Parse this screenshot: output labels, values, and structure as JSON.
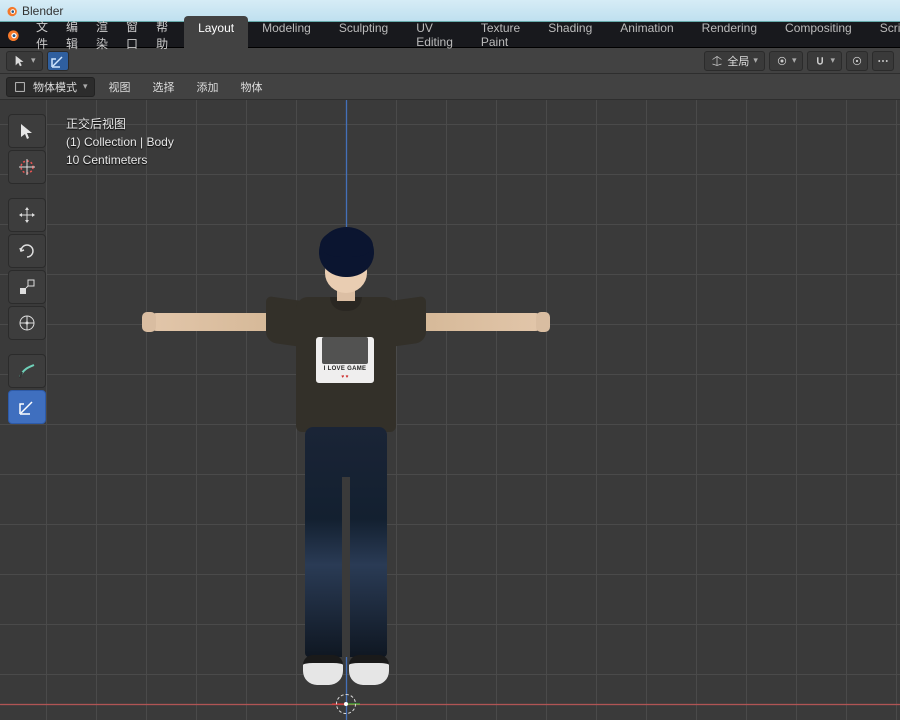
{
  "app": {
    "title": "Blender"
  },
  "menu": {
    "items": [
      "文件",
      "编辑",
      "渲染",
      "窗口",
      "帮助"
    ]
  },
  "workspace_tabs": {
    "tabs": [
      "Layout",
      "Modeling",
      "Sculpting",
      "UV Editing",
      "Texture Paint",
      "Shading",
      "Animation",
      "Rendering",
      "Compositing",
      "Scripting"
    ],
    "active": "Layout"
  },
  "header": {
    "orientation_label": "全局",
    "snap_tooltip": "Snap"
  },
  "subheader": {
    "mode": "物体模式",
    "menus": [
      "视图",
      "选择",
      "添加",
      "物体"
    ]
  },
  "hud": {
    "line1": "正交后视图",
    "line2": "(1) Collection | Body",
    "line3": "10 Centimeters"
  },
  "tools": [
    {
      "id": "select-box",
      "selected": false
    },
    {
      "id": "cursor",
      "selected": false
    },
    {
      "id": "move",
      "selected": false
    },
    {
      "id": "rotate",
      "selected": false
    },
    {
      "id": "scale",
      "selected": false
    },
    {
      "id": "transform",
      "selected": false
    },
    {
      "id": "annotate",
      "selected": false
    },
    {
      "id": "measure",
      "selected": true
    }
  ],
  "character": {
    "shirt_print_text": "I LOVE GAME",
    "shirt_color": "#333029",
    "hair_color": "#0b1530",
    "jeans_color": "#1a2436"
  },
  "viewport": {
    "grid_spacing_label": "10 Centimeters",
    "axis_vertical": "Z",
    "axis_horizontal": "X"
  }
}
